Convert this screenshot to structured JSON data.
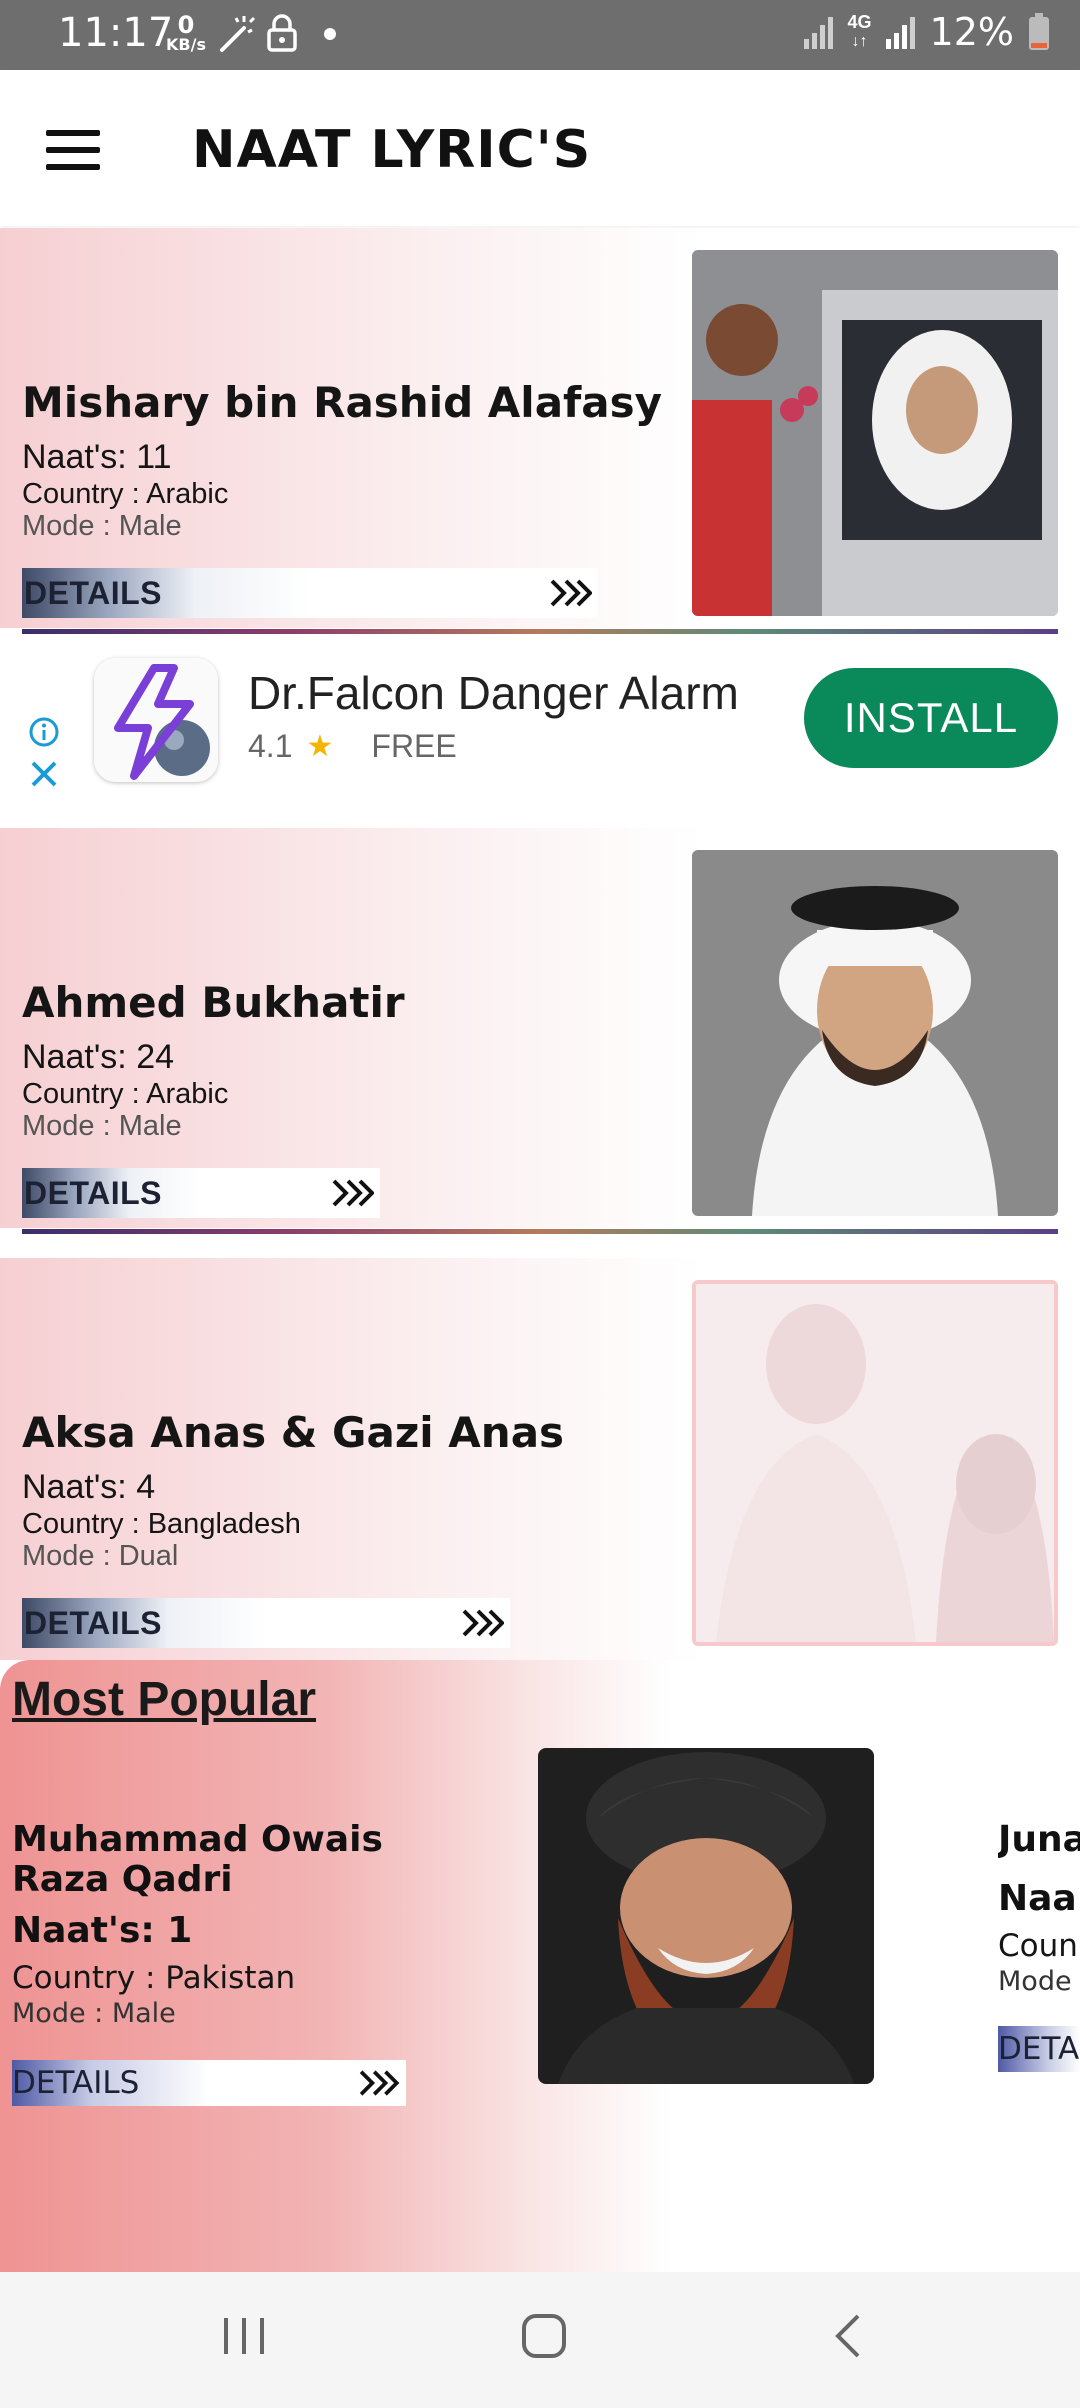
{
  "status_bar": {
    "time": "11:17",
    "speed_value": "0",
    "speed_unit": "KB/s",
    "network": "4G",
    "battery": "12%"
  },
  "app_bar": {
    "title": "NAAT LYRIC'S",
    "menu_icon": "hamburger-menu-icon"
  },
  "reciters": [
    {
      "name": "Mishary bin Rashid Alafasy",
      "naats": "Naat's: 11",
      "country": "Country : Arabic",
      "mode": "Mode : Male",
      "details_label": "DETAILS"
    },
    {
      "name": "Ahmed Bukhatir",
      "naats": "Naat's: 24",
      "country": "Country : Arabic",
      "mode": "Mode : Male",
      "details_label": "DETAILS"
    },
    {
      "name": "Aksa Anas & Gazi Anas",
      "naats": "Naat's: 4",
      "country": "Country : Bangladesh",
      "mode": "Mode : Dual",
      "details_label": "DETAILS"
    }
  ],
  "ad": {
    "title": "Dr.Falcon Danger Alarm",
    "rating": "4.1",
    "price": "FREE",
    "install_label": "INSTALL",
    "accent": "#0a8a5a"
  },
  "popular": {
    "title": "Most Popular",
    "items": [
      {
        "name": "Muhammad Owais Raza Qadri",
        "naats": "Naat's: 1",
        "country": "Country : Pakistan",
        "mode": "Mode : Male",
        "details_label": "DETAILS"
      },
      {
        "name": "Juna",
        "naats": "Naa",
        "country": "Coun",
        "mode": "Mode",
        "details_label": "DETA"
      }
    ]
  },
  "nav_bar": {
    "recents_icon": "recents-icon",
    "home_icon": "home-icon",
    "back_icon": "back-icon"
  }
}
